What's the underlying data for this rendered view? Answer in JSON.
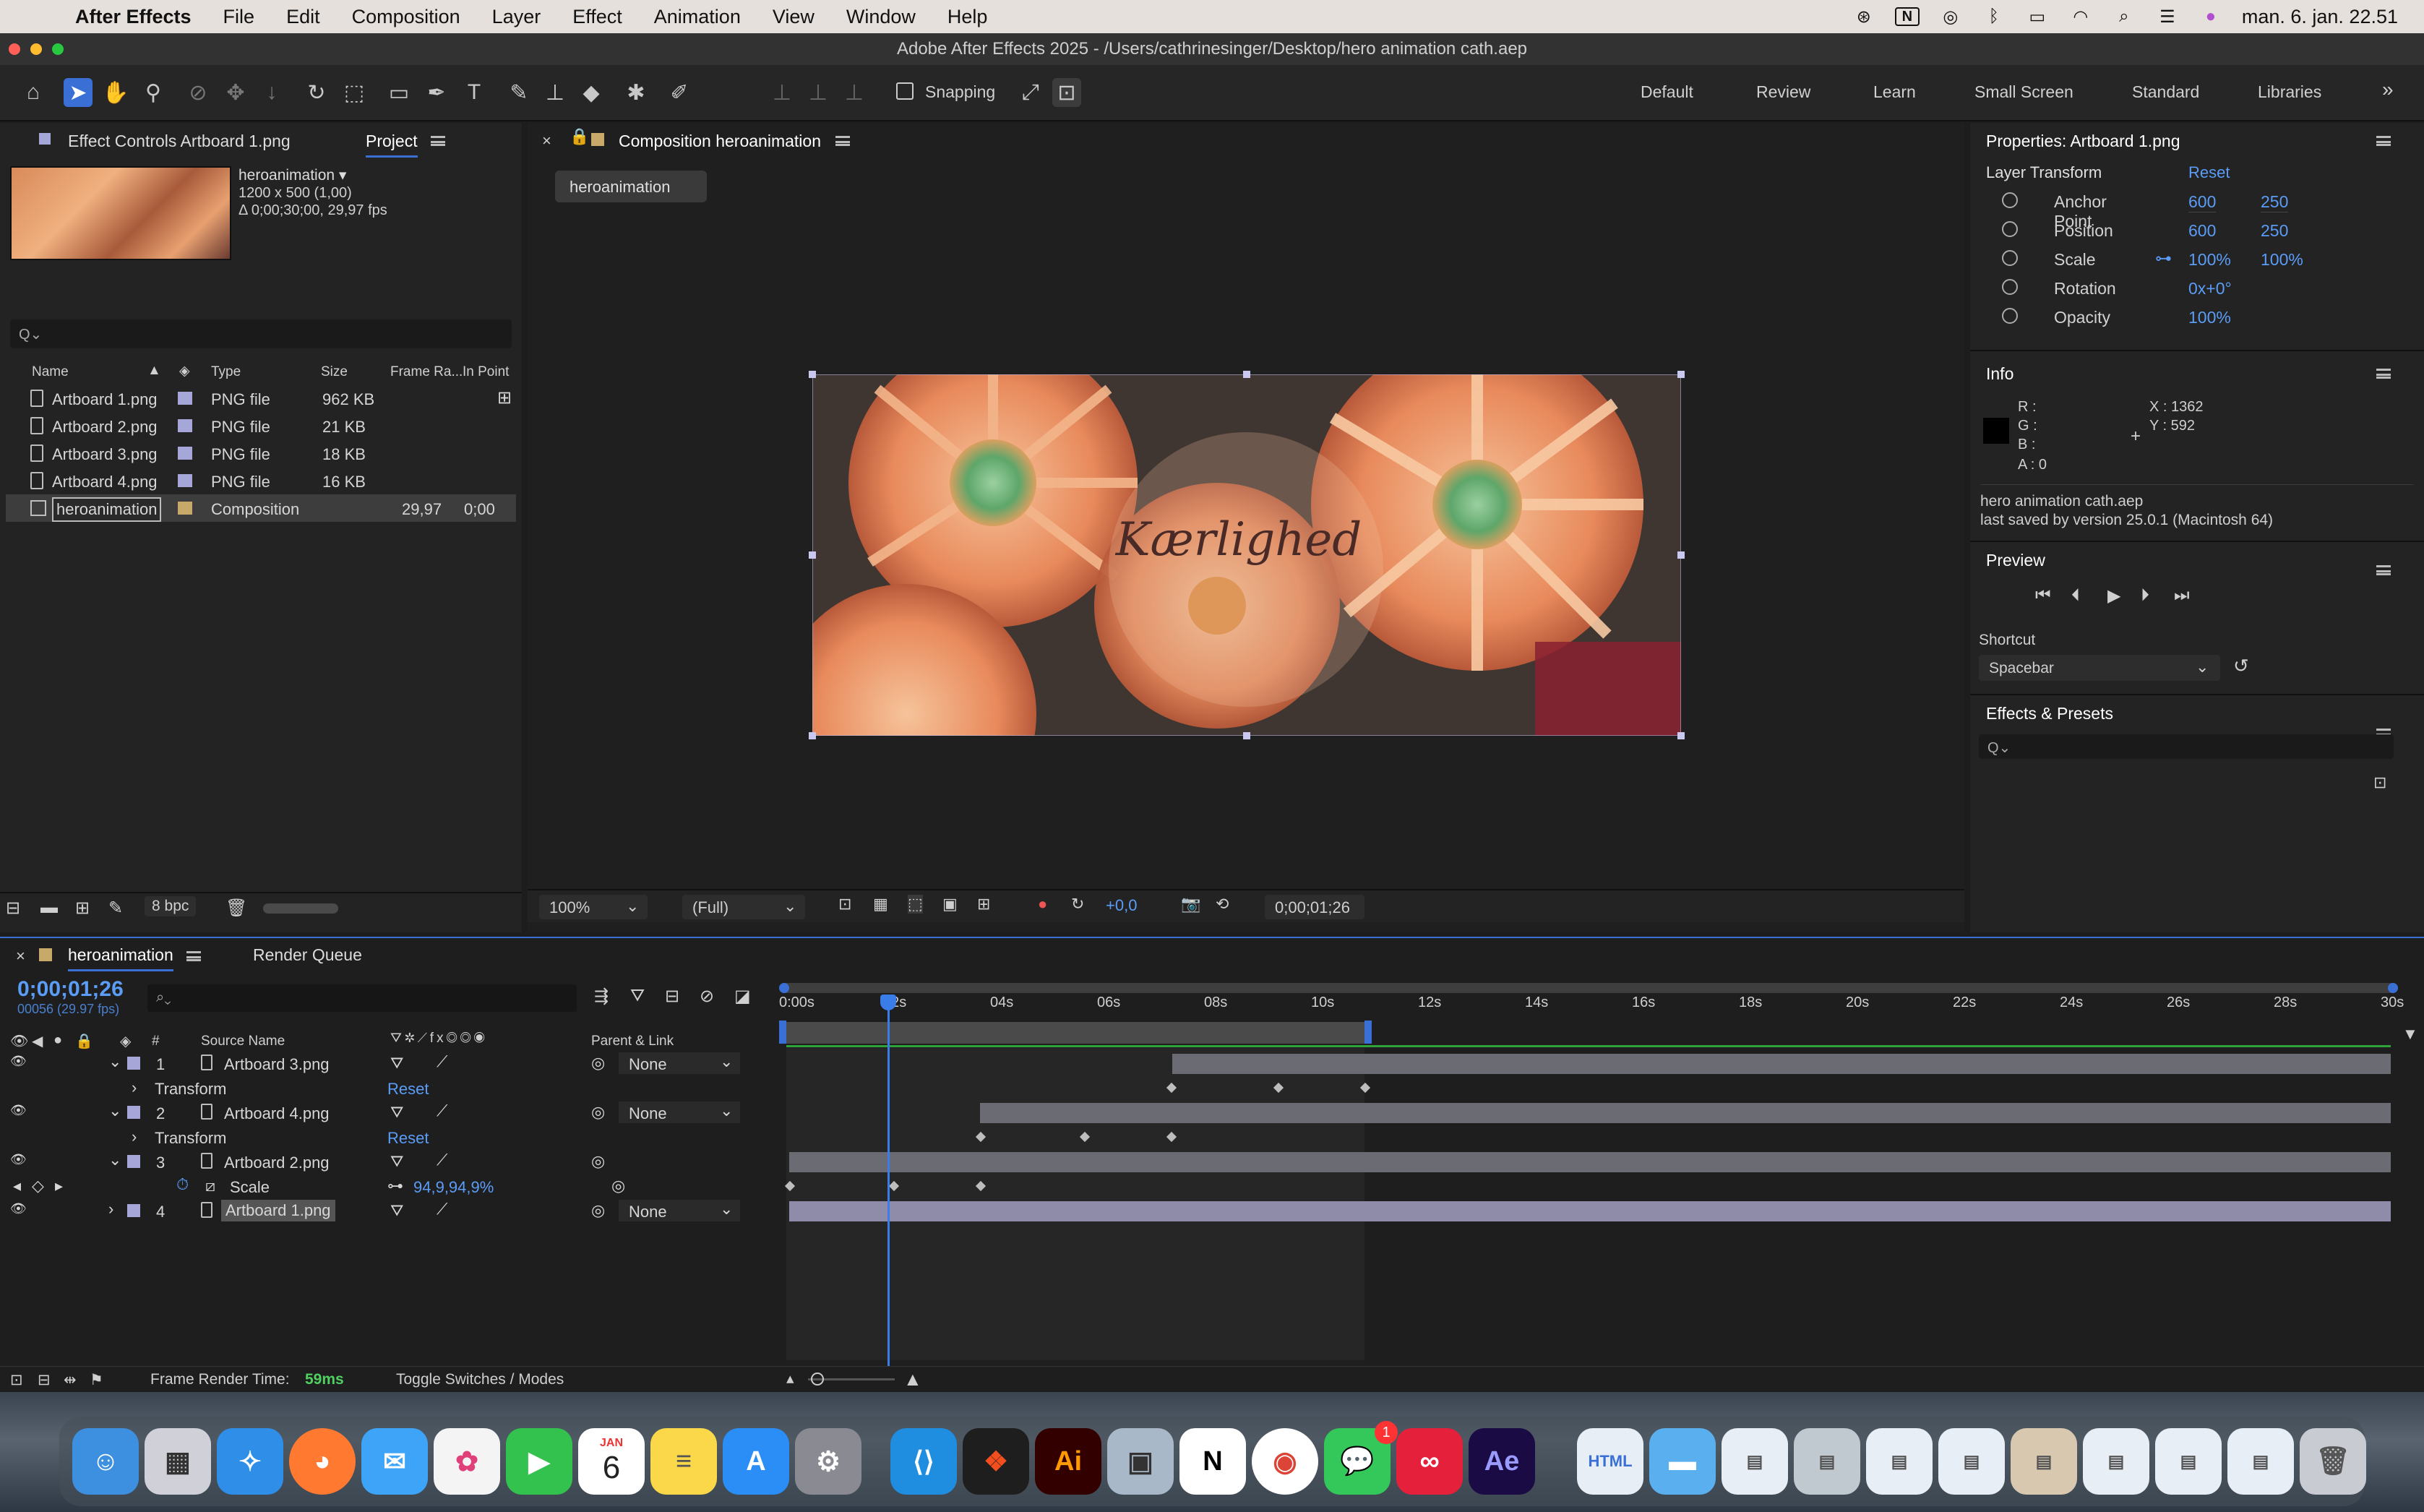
{
  "menubar": {
    "app_name": "After Effects",
    "items": [
      "File",
      "Edit",
      "Composition",
      "Layer",
      "Effect",
      "Animation",
      "View",
      "Window",
      "Help"
    ],
    "clock": "man. 6. jan.  22.51"
  },
  "window": {
    "title": "Adobe After Effects 2025 - /Users/cathrinesinger/Desktop/hero animation cath.aep"
  },
  "toolbar": {
    "snapping_label": "Snapping",
    "workspaces": [
      "Default",
      "Review",
      "Learn",
      "Small Screen",
      "Standard",
      "Libraries"
    ],
    "more": "»"
  },
  "project_panel": {
    "tab_effect_controls": "Effect Controls Artboard 1.png",
    "tab_project": "Project",
    "preview_name": "heroanimation ▾",
    "preview_dims": "1200 x 500 (1,00)",
    "preview_duration": "Δ 0;00;30;00, 29,97 fps",
    "search_placeholder": "Q⌄",
    "columns": {
      "name": "Name",
      "type": "Type",
      "size": "Size",
      "frame_rate": "Frame Ra...",
      "in_point": "In Point"
    },
    "rows": [
      {
        "name": "Artboard 1.png",
        "type": "PNG file",
        "size": "962 KB",
        "fps": "",
        "in": ""
      },
      {
        "name": "Artboard 2.png",
        "type": "PNG file",
        "size": "21 KB",
        "fps": "",
        "in": ""
      },
      {
        "name": "Artboard 3.png",
        "type": "PNG file",
        "size": "18 KB",
        "fps": "",
        "in": ""
      },
      {
        "name": "Artboard 4.png",
        "type": "PNG file",
        "size": "16 KB",
        "fps": "",
        "in": ""
      },
      {
        "name": "heroanimation",
        "type": "Composition",
        "size": "",
        "fps": "29,97",
        "in": "0;00"
      }
    ],
    "bpc": "8 bpc"
  },
  "composition_panel": {
    "title": "Composition heroanimation",
    "comp_tab": "heroanimation",
    "overlay_text": "Kærlighed",
    "zoom": "100%",
    "resolution": "(Full)",
    "exposure": "+0,0",
    "timecode": "0;00;01;26"
  },
  "properties_panel": {
    "title": "Properties: Artboard 1.png",
    "section": "Layer Transform",
    "reset": "Reset",
    "props": [
      {
        "name": "Anchor Point",
        "v1": "600",
        "v2": "250"
      },
      {
        "name": "Position",
        "v1": "600",
        "v2": "250"
      },
      {
        "name": "Scale",
        "v1": "100%",
        "v2": "100%"
      },
      {
        "name": "Rotation",
        "v1": "0x+0°",
        "v2": ""
      },
      {
        "name": "Opacity",
        "v1": "100%",
        "v2": ""
      }
    ]
  },
  "info_panel": {
    "title": "Info",
    "r": "R :",
    "g": "G :",
    "b": "B :",
    "a": "A :  0",
    "x": "X : 1362",
    "y": "Y : 592",
    "file": "hero animation cath.aep",
    "saved": "last saved by version 25.0.1 (Macintosh 64)"
  },
  "preview_panel": {
    "title": "Preview",
    "shortcut_label": "Shortcut",
    "shortcut_value": "Spacebar"
  },
  "effects_panel": {
    "title": "Effects & Presets",
    "search_placeholder": "Q⌄"
  },
  "timeline": {
    "tab": "heroanimation",
    "render_queue": "Render Queue",
    "timecode": "0;00;01;26",
    "frames": "00056 (29.97 fps)",
    "col_source": "Source Name",
    "col_parent": "Parent & Link",
    "col_hash": "#",
    "ruler": [
      "0:00s",
      "02s",
      "04s",
      "06s",
      "08s",
      "10s",
      "12s",
      "14s",
      "16s",
      "18s",
      "20s",
      "22s",
      "24s",
      "26s",
      "28s",
      "30s"
    ],
    "layers": [
      {
        "num": "1",
        "name": "Artboard 3.png",
        "parent": "None"
      },
      {
        "sub": "Transform",
        "reset": "Reset"
      },
      {
        "num": "2",
        "name": "Artboard 4.png",
        "parent": "None"
      },
      {
        "sub": "Transform",
        "reset": "Reset"
      },
      {
        "num": "3",
        "name": "Artboard 2.png",
        "parent": ""
      },
      {
        "prop": "Scale",
        "value": "94,9,94,9%"
      },
      {
        "num": "4",
        "name": "Artboard 1.png",
        "parent": "None"
      }
    ],
    "render_time_label": "Frame Render Time:",
    "render_time_value": "59ms",
    "toggle": "Toggle Switches / Modes"
  },
  "dock": {
    "calendar_month": "JAN",
    "calendar_day": "6",
    "messages_badge": "1",
    "apps": [
      "Finder",
      "Launchpad",
      "Safari",
      "Firefox",
      "Mail",
      "Photos",
      "FaceTime",
      "Calendar",
      "Notes",
      "App Store",
      "System Settings",
      "VS Code",
      "Figma",
      "Illustrator",
      "Preview",
      "Notion",
      "Chrome",
      "Messages",
      "Creative Cloud",
      "After Effects",
      "Files",
      "Folder",
      "Trash"
    ]
  },
  "colors": {
    "accent": "#3a6fd6",
    "blue_value": "#5b9cf7",
    "layer_bar": "#6b6b73",
    "layer_bar_sel": "#8f8caa",
    "work_area": "#2fa33a"
  }
}
